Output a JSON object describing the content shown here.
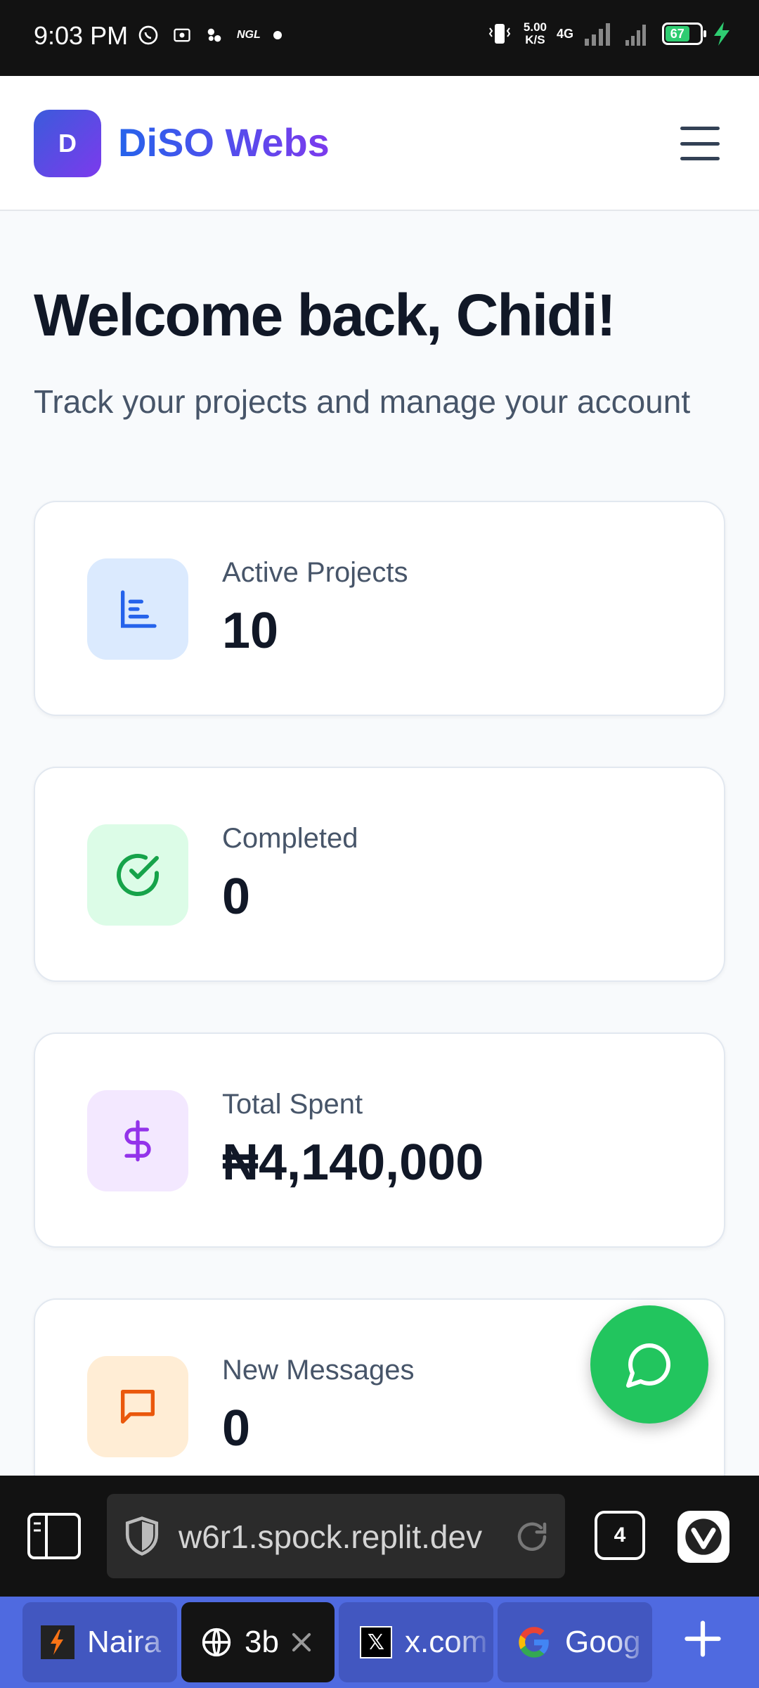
{
  "status_bar": {
    "time": "9:03 PM",
    "ngl": "NGL",
    "net_speed_value": "5.00",
    "net_speed_unit": "K/S",
    "network": "4G",
    "battery": "67"
  },
  "header": {
    "logo_letter": "D",
    "brand": "DiSO Webs"
  },
  "main": {
    "welcome": "Welcome back, Chidi!",
    "subtitle": "Track your projects and manage your account",
    "stats": [
      {
        "label": "Active Projects",
        "value": "10",
        "icon": "chart-icon",
        "color": "#2563eb"
      },
      {
        "label": "Completed",
        "value": "0",
        "icon": "check-circle-icon",
        "color": "#16a34a"
      },
      {
        "label": "Total Spent",
        "value": "₦4,140,000",
        "icon": "dollar-icon",
        "color": "#9333ea"
      },
      {
        "label": "New Messages",
        "value": "0",
        "icon": "message-icon",
        "color": "#ea580c"
      }
    ]
  },
  "browser": {
    "url": "w6r1.spock.replit.dev",
    "tab_count": "4",
    "tabs": [
      {
        "label": "Naira"
      },
      {
        "label": "3b"
      },
      {
        "label": "x.com"
      },
      {
        "label": "Goog"
      }
    ]
  }
}
